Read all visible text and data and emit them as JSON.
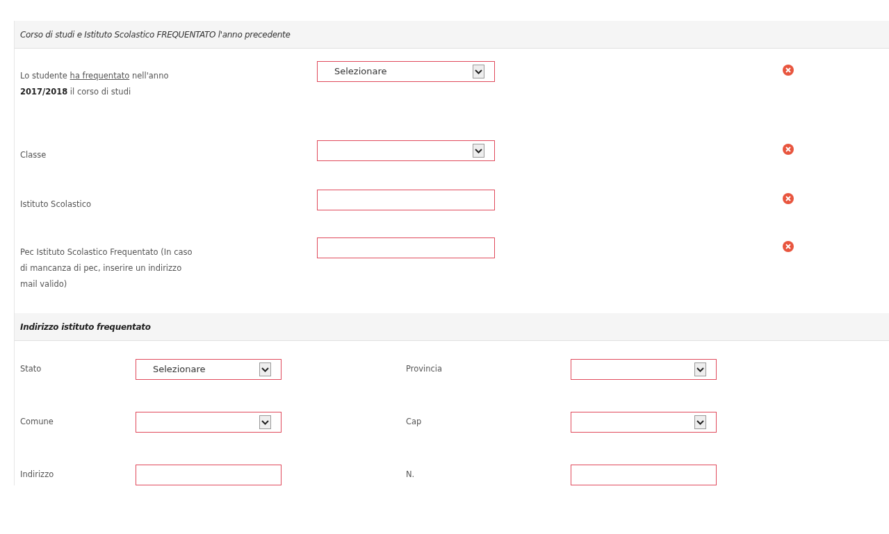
{
  "section": {
    "title": "Corso di studi e Istituto Scolastico FREQUENTATO l'anno precedente",
    "rows": [
      {
        "label": [
          {
            "kind": "plain",
            "text": "Lo studente "
          },
          {
            "kind": "underline",
            "text": "ha frequentato"
          },
          {
            "kind": "plain",
            "text": " nell'anno "
          },
          {
            "kind": "bold",
            "text": "2017/2018"
          },
          {
            "kind": "plain",
            "text": " il corso di studi"
          }
        ],
        "field": {
          "kind": "select",
          "value": "Selezionare",
          "invalid": true
        }
      },
      {
        "label": [
          {
            "kind": "plain",
            "text": "Classe"
          }
        ],
        "field": {
          "kind": "select",
          "invalid": true
        }
      },
      {
        "label": [
          {
            "kind": "plain",
            "text": "Istituto Scolastico"
          }
        ],
        "field": {
          "kind": "text",
          "invalid": true
        }
      },
      {
        "label": [
          {
            "kind": "plain",
            "text": "Pec Istituto Scolastico Frequentato (In caso di mancanza di pec, inserire un indirizzo mail valido)"
          }
        ],
        "field": {
          "kind": "text",
          "invalid": true
        }
      }
    ]
  },
  "address": {
    "title": "Indirizzo istituto frequentato",
    "fields": [
      {
        "label": "Stato",
        "kind": "select",
        "value": "Selezionare",
        "invalid": true
      },
      {
        "label": "Provincia",
        "kind": "select",
        "invalid": true
      },
      {
        "label": "Comune",
        "kind": "select",
        "invalid": true
      },
      {
        "label": "Cap",
        "kind": "select",
        "invalid": true
      },
      {
        "label": "Indirizzo",
        "kind": "text",
        "invalid": true
      },
      {
        "label": "N.",
        "kind": "text",
        "invalid": true
      }
    ]
  }
}
